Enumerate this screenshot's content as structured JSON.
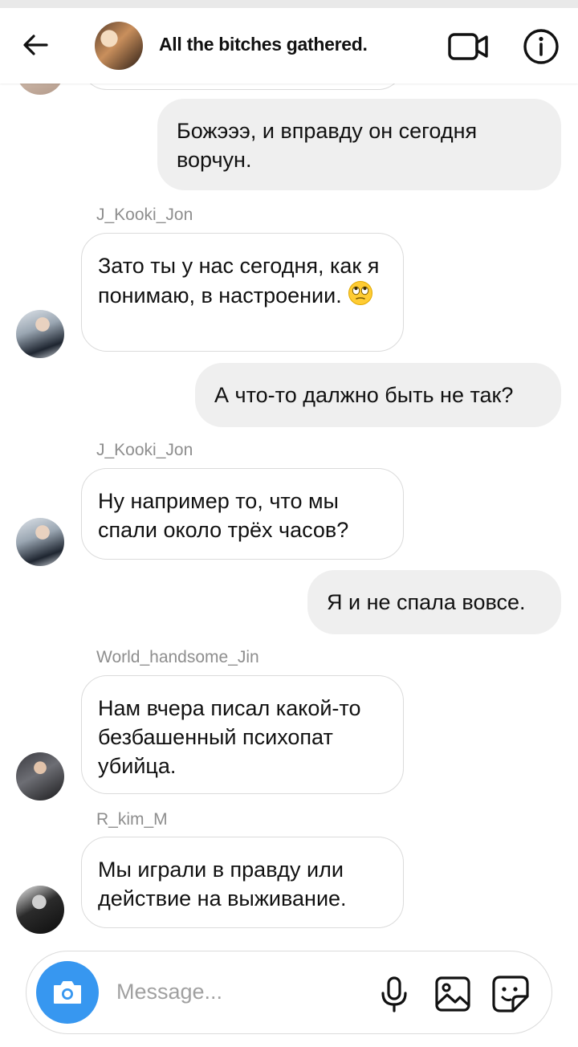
{
  "header": {
    "back_icon": "arrow-left-icon",
    "group_title": "All the bitches gathered.",
    "video_icon": "video-camera-icon",
    "info_icon": "info-icon"
  },
  "messages": [
    {
      "type": "out",
      "text": "Божэээ, и вправду он сегодня ворчун."
    },
    {
      "type": "in",
      "sender": "J_Kooki_Jon",
      "text": "Зато ты у нас сегодня, как я понимаю, в настроении.",
      "emoji": "face-with-rolling-eyes"
    },
    {
      "type": "out",
      "text": "А что-то далжно быть не так?"
    },
    {
      "type": "in",
      "sender": "J_Kooki_Jon",
      "text": "Ну например то, что мы спали около трёх часов?"
    },
    {
      "type": "out",
      "text": "Я и не спала вовсе."
    },
    {
      "type": "in",
      "sender": "World_handsome_Jin",
      "text": "Нам вчера писал какой-то безбашенный психопат убийца."
    },
    {
      "type": "in",
      "sender": "R_kim_M",
      "text": "Мы играли в правду или действие на выживание."
    }
  ],
  "composer": {
    "placeholder": "Message...",
    "camera_icon": "camera-icon",
    "mic_icon": "microphone-icon",
    "gallery_icon": "image-gallery-icon",
    "sticker_icon": "sticker-icon"
  },
  "colors": {
    "accent": "#3797f0",
    "outgoing_bubble": "#efefef",
    "incoming_border": "#dbdbdb",
    "sender_text": "#8e8e8e"
  }
}
